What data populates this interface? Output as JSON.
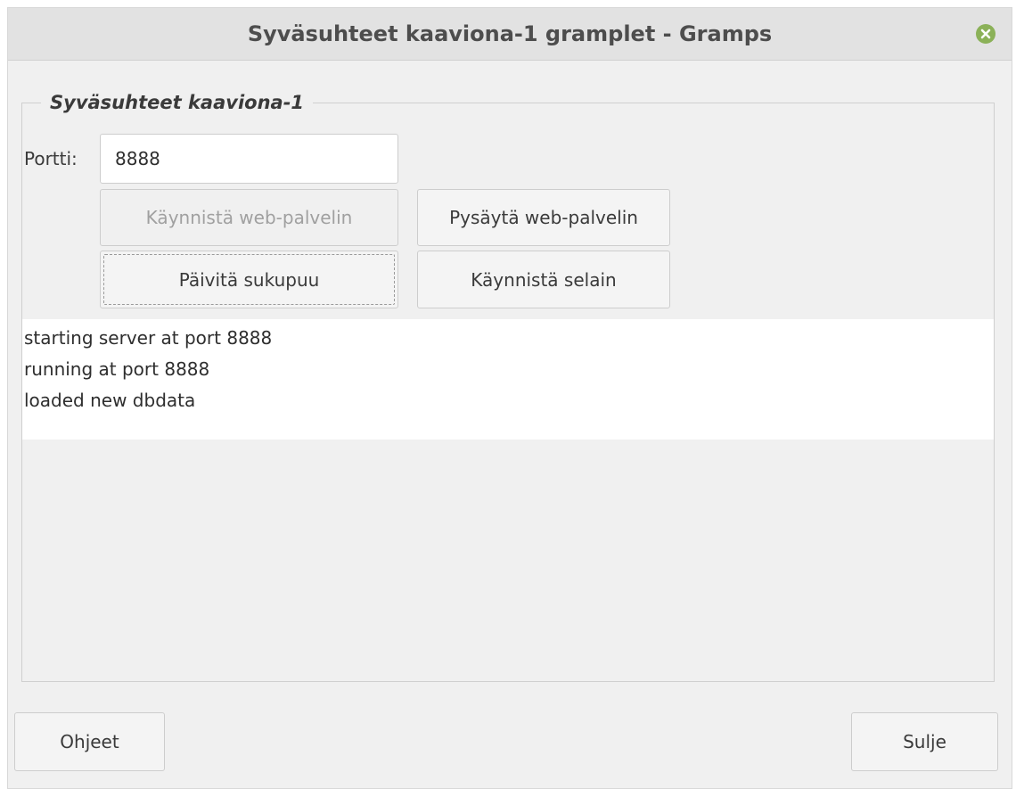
{
  "window": {
    "title": "Syväsuhteet kaaviona-1 gramplet - Gramps"
  },
  "frame": {
    "label": "Syväsuhteet kaaviona-1"
  },
  "port": {
    "label": "Portti:",
    "value": "8888"
  },
  "buttons": {
    "start_server": "Käynnistä web-palvelin",
    "stop_server": "Pysäytä web-palvelin",
    "refresh_tree": "Päivitä sukupuu",
    "launch_browser": "Käynnistä selain",
    "help": "Ohjeet",
    "close": "Sulje"
  },
  "log": {
    "lines": [
      "starting server at port 8888",
      "running at port 8888",
      "loaded new dbdata"
    ]
  },
  "colors": {
    "close_button": "#8bb158"
  },
  "icons": {
    "close": "close-icon"
  }
}
